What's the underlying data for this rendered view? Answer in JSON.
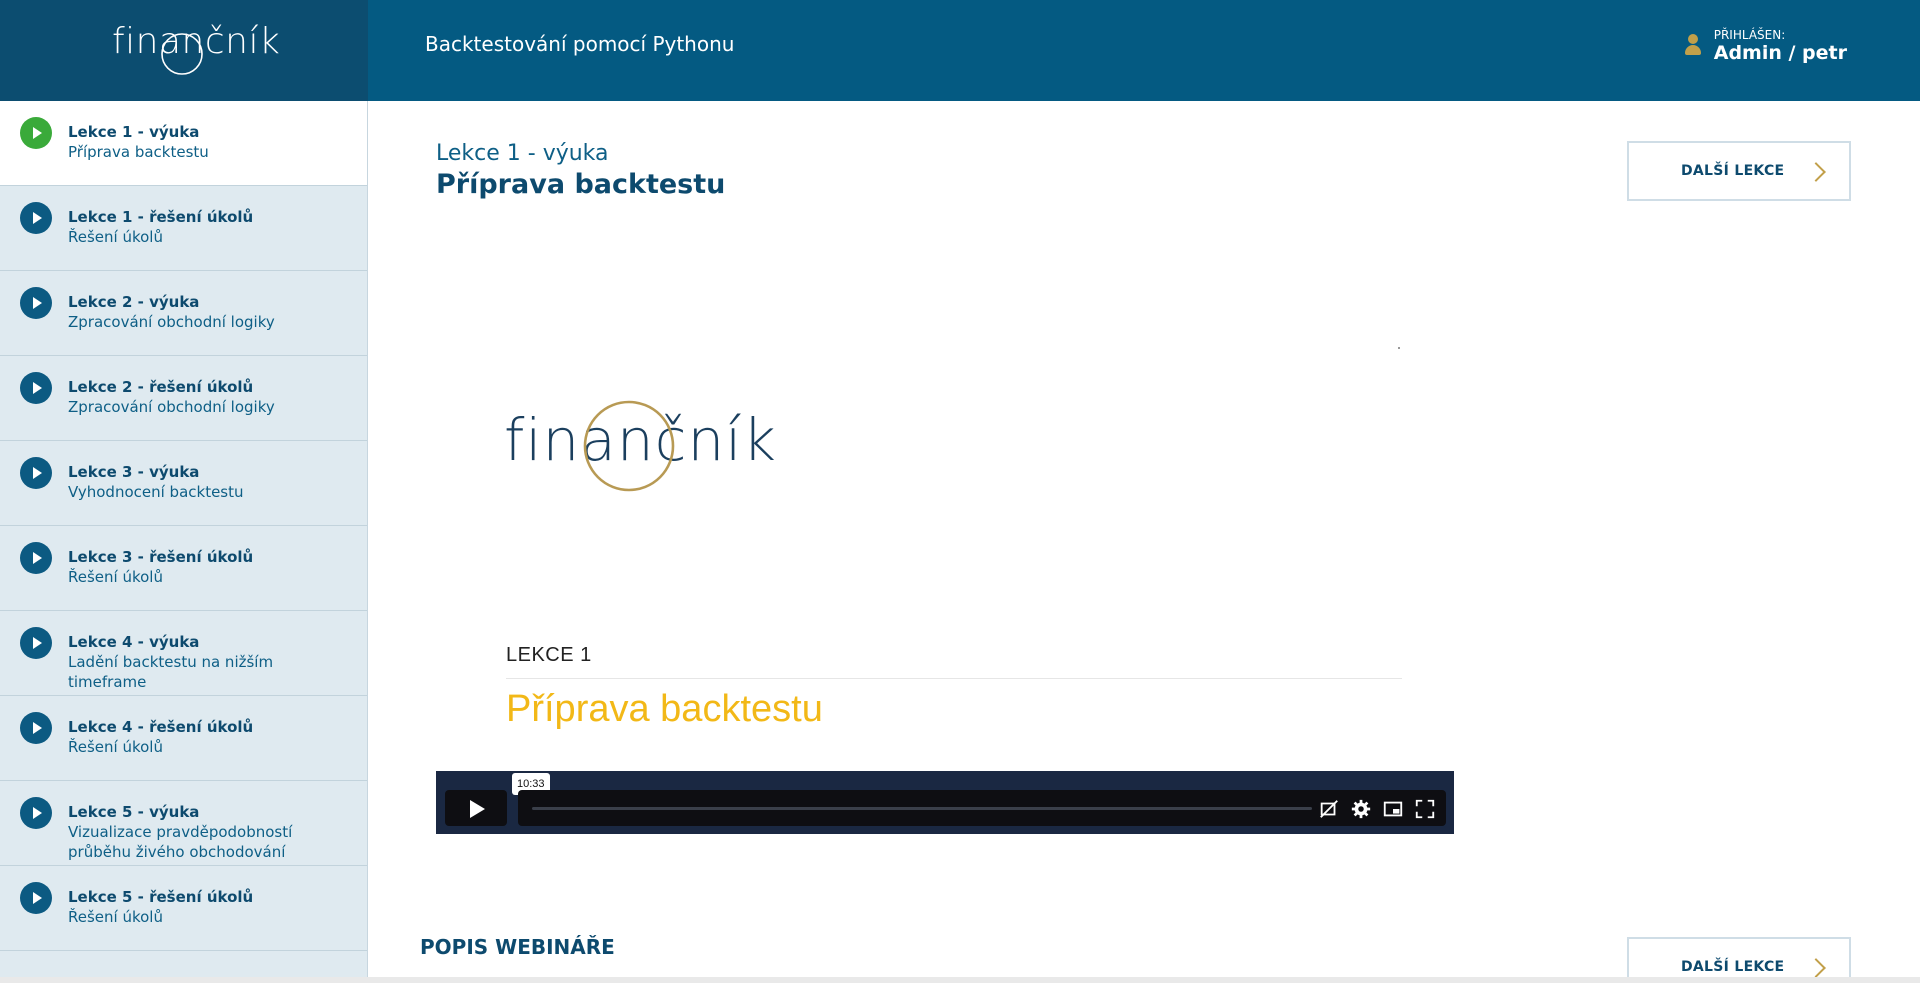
{
  "brand": {
    "logo_text": "finančník"
  },
  "header": {
    "course_title": "Backtestování pomocí Pythonu",
    "user_label": "PŘIHLÁŠEN:",
    "user_name": "Admin / petr"
  },
  "sidebar": {
    "items": [
      {
        "title": "Lekce 1 - výuka",
        "subtitle": "Příprava backtestu",
        "active": true
      },
      {
        "title": "Lekce 1 - řešení úkolů",
        "subtitle": "Řešení úkolů",
        "active": false
      },
      {
        "title": "Lekce 2 - výuka",
        "subtitle": "Zpracování obchodní logiky",
        "active": false
      },
      {
        "title": "Lekce 2 - řešení úkolů",
        "subtitle": "Zpracování obchodní logiky",
        "active": false
      },
      {
        "title": "Lekce 3 - výuka",
        "subtitle": "Vyhodnocení backtestu",
        "active": false
      },
      {
        "title": "Lekce 3 - řešení úkolů",
        "subtitle": "Řešení úkolů",
        "active": false
      },
      {
        "title": "Lekce 4 - výuka",
        "subtitle": "Ladění backtestu na nižším timeframe",
        "active": false
      },
      {
        "title": "Lekce 4 - řešení úkolů",
        "subtitle": "Řešení úkolů",
        "active": false
      },
      {
        "title": "Lekce 5 - výuka",
        "subtitle": "Vizualizace pravděpodobností průběhu živého obchodování",
        "active": false
      },
      {
        "title": "Lekce 5 - řešení úkolů",
        "subtitle": "Řešení úkolů",
        "active": false
      }
    ]
  },
  "main": {
    "lesson_small": "Lekce 1 - výuka",
    "lesson_big": "Příprava backtestu",
    "next_label": "DALŠÍ LEKCE",
    "section_title": "POPIS WEBINÁŘE"
  },
  "video": {
    "slide_logo": "finančník",
    "slide_lekce": "LEKCE 1",
    "slide_title": "Příprava backtestu",
    "time_tooltip": "10:33",
    "icons": [
      "captions-off-icon",
      "settings-icon",
      "picture-in-picture-icon",
      "fullscreen-icon"
    ]
  },
  "colors": {
    "topbar": "#045a82",
    "brand_box": "#0c4d70",
    "sidebar_bg": "#dfeaf0",
    "active_play": "#3aaa3a",
    "play": "#0c5a82",
    "accent_gold": "#c2a04a",
    "slide_title": "#f2b817",
    "player_bg": "#1a2842"
  }
}
